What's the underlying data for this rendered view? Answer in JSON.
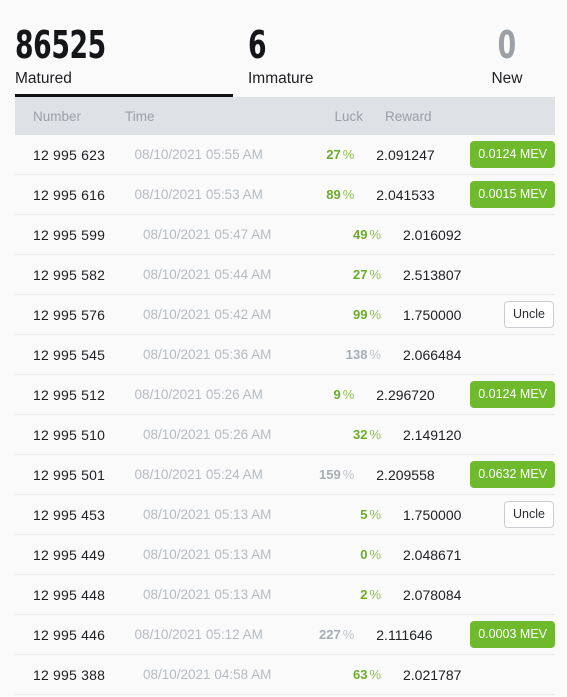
{
  "tabs": [
    {
      "value": "86525",
      "label": "Matured",
      "active": true,
      "muted": false
    },
    {
      "value": "6",
      "label": "Immature",
      "active": false,
      "muted": false
    },
    {
      "value": "0",
      "label": "New",
      "active": false,
      "muted": true
    }
  ],
  "table": {
    "columns": [
      "Number",
      "Time",
      "Luck",
      "Reward"
    ],
    "colors": {
      "badge_mev_bg": "#6fba2c",
      "badge_mev_text": "#ffffff",
      "luck_green": "#6aab2b",
      "luck_gray": "#a8aeb5",
      "header_bg": "#dee2e6",
      "time_text": "#b6bcc2"
    },
    "rows": [
      {
        "number": "12 995 623",
        "time": "08/10/2021 05:55 AM",
        "luck": "27",
        "luck_unit": "%",
        "luck_high": false,
        "reward": "2.091247",
        "badge": "0.0124 MEV",
        "badge_type": "mev"
      },
      {
        "number": "12 995 616",
        "time": "08/10/2021 05:53 AM",
        "luck": "89",
        "luck_unit": "%",
        "luck_high": false,
        "reward": "2.041533",
        "badge": "0.0015 MEV",
        "badge_type": "mev"
      },
      {
        "number": "12 995 599",
        "time": "08/10/2021 05:47 AM",
        "luck": "49",
        "luck_unit": "%",
        "luck_high": false,
        "reward": "2.016092",
        "badge": "",
        "badge_type": "none"
      },
      {
        "number": "12 995 582",
        "time": "08/10/2021 05:44 AM",
        "luck": "27",
        "luck_unit": "%",
        "luck_high": false,
        "reward": "2.513807",
        "badge": "",
        "badge_type": "none"
      },
      {
        "number": "12 995 576",
        "time": "08/10/2021 05:42 AM",
        "luck": "99",
        "luck_unit": "%",
        "luck_high": false,
        "reward": "1.750000",
        "badge": "Uncle",
        "badge_type": "uncle"
      },
      {
        "number": "12 995 545",
        "time": "08/10/2021 05:36 AM",
        "luck": "138",
        "luck_unit": "%",
        "luck_high": true,
        "reward": "2.066484",
        "badge": "",
        "badge_type": "none"
      },
      {
        "number": "12 995 512",
        "time": "08/10/2021 05:26 AM",
        "luck": "9",
        "luck_unit": "%",
        "luck_high": false,
        "reward": "2.296720",
        "badge": "0.0124 MEV",
        "badge_type": "mev"
      },
      {
        "number": "12 995 510",
        "time": "08/10/2021 05:26 AM",
        "luck": "32",
        "luck_unit": "%",
        "luck_high": false,
        "reward": "2.149120",
        "badge": "",
        "badge_type": "none"
      },
      {
        "number": "12 995 501",
        "time": "08/10/2021 05:24 AM",
        "luck": "159",
        "luck_unit": "%",
        "luck_high": true,
        "reward": "2.209558",
        "badge": "0.0632 MEV",
        "badge_type": "mev"
      },
      {
        "number": "12 995 453",
        "time": "08/10/2021 05:13 AM",
        "luck": "5",
        "luck_unit": "%",
        "luck_high": false,
        "reward": "1.750000",
        "badge": "Uncle",
        "badge_type": "uncle"
      },
      {
        "number": "12 995 449",
        "time": "08/10/2021 05:13 AM",
        "luck": "0",
        "luck_unit": "%",
        "luck_high": false,
        "reward": "2.048671",
        "badge": "",
        "badge_type": "none"
      },
      {
        "number": "12 995 448",
        "time": "08/10/2021 05:13 AM",
        "luck": "2",
        "luck_unit": "%",
        "luck_high": false,
        "reward": "2.078084",
        "badge": "",
        "badge_type": "none"
      },
      {
        "number": "12 995 446",
        "time": "08/10/2021 05:12 AM",
        "luck": "227",
        "luck_unit": "%",
        "luck_high": true,
        "reward": "2.111646",
        "badge": "0.0003 MEV",
        "badge_type": "mev"
      },
      {
        "number": "12 995 388",
        "time": "08/10/2021 04:58 AM",
        "luck": "63",
        "luck_unit": "%",
        "luck_high": false,
        "reward": "2.021787",
        "badge": "",
        "badge_type": "none"
      }
    ]
  }
}
